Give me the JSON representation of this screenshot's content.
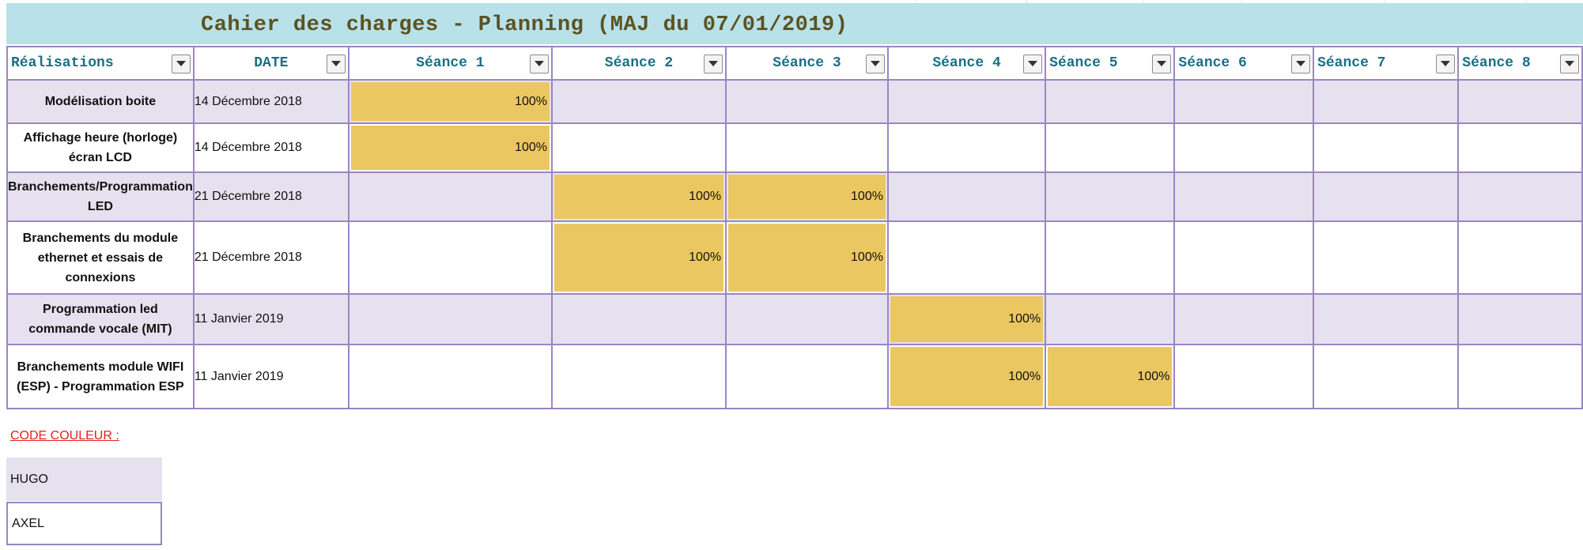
{
  "title": "Cahier des charges - Planning (MAJ du 07/01/2019)",
  "headers": [
    "Réalisations",
    "DATE",
    "Séance 1",
    "Séance 2",
    "Séance 3",
    "Séance 4",
    "Séance 5",
    "Séance 6",
    "Séance 7",
    "Séance 8"
  ],
  "rows": [
    {
      "task": "Modélisation boite",
      "date": "14 Décembre 2018",
      "cells": [
        "100%",
        "",
        "",
        "",
        "",
        "",
        "",
        ""
      ]
    },
    {
      "task": "Affichage heure (horloge) écran LCD",
      "date": "14 Décembre 2018",
      "cells": [
        "100%",
        "",
        "",
        "",
        "",
        "",
        "",
        ""
      ]
    },
    {
      "task": "Branchements/Programmation LED",
      "date": "21 Décembre 2018",
      "cells": [
        "",
        "100%",
        "100%",
        "",
        "",
        "",
        "",
        ""
      ]
    },
    {
      "task": "Branchements du module ethernet et essais de connexions",
      "date": "21 Décembre 2018",
      "cells": [
        "",
        "100%",
        "100%",
        "",
        "",
        "",
        "",
        ""
      ]
    },
    {
      "task": "Programmation led commande vocale (MIT)",
      "date": "11 Janvier 2019",
      "cells": [
        "",
        "",
        "",
        "100%",
        "",
        "",
        "",
        ""
      ]
    },
    {
      "task": "Branchements module WIFI (ESP) - Programmation ESP",
      "date": "11 Janvier 2019",
      "cells": [
        "",
        "",
        "",
        "100%",
        "100%",
        "",
        "",
        ""
      ]
    }
  ],
  "legend": {
    "title": "CODE COULEUR :",
    "items": [
      {
        "label": "HUGO",
        "color": "#e6e1ee"
      },
      {
        "label": "AXEL",
        "color": "#ffffff"
      }
    ]
  },
  "colors": {
    "title_band": "#b9e1ea",
    "header_text": "#1c6f84",
    "progress_fill": "#ebc762",
    "row_alt": "#e6e1ee",
    "border": "#9a86c4",
    "legend_title": "#e0201b"
  },
  "icons": {
    "filter": "dropdown-arrow-icon"
  }
}
